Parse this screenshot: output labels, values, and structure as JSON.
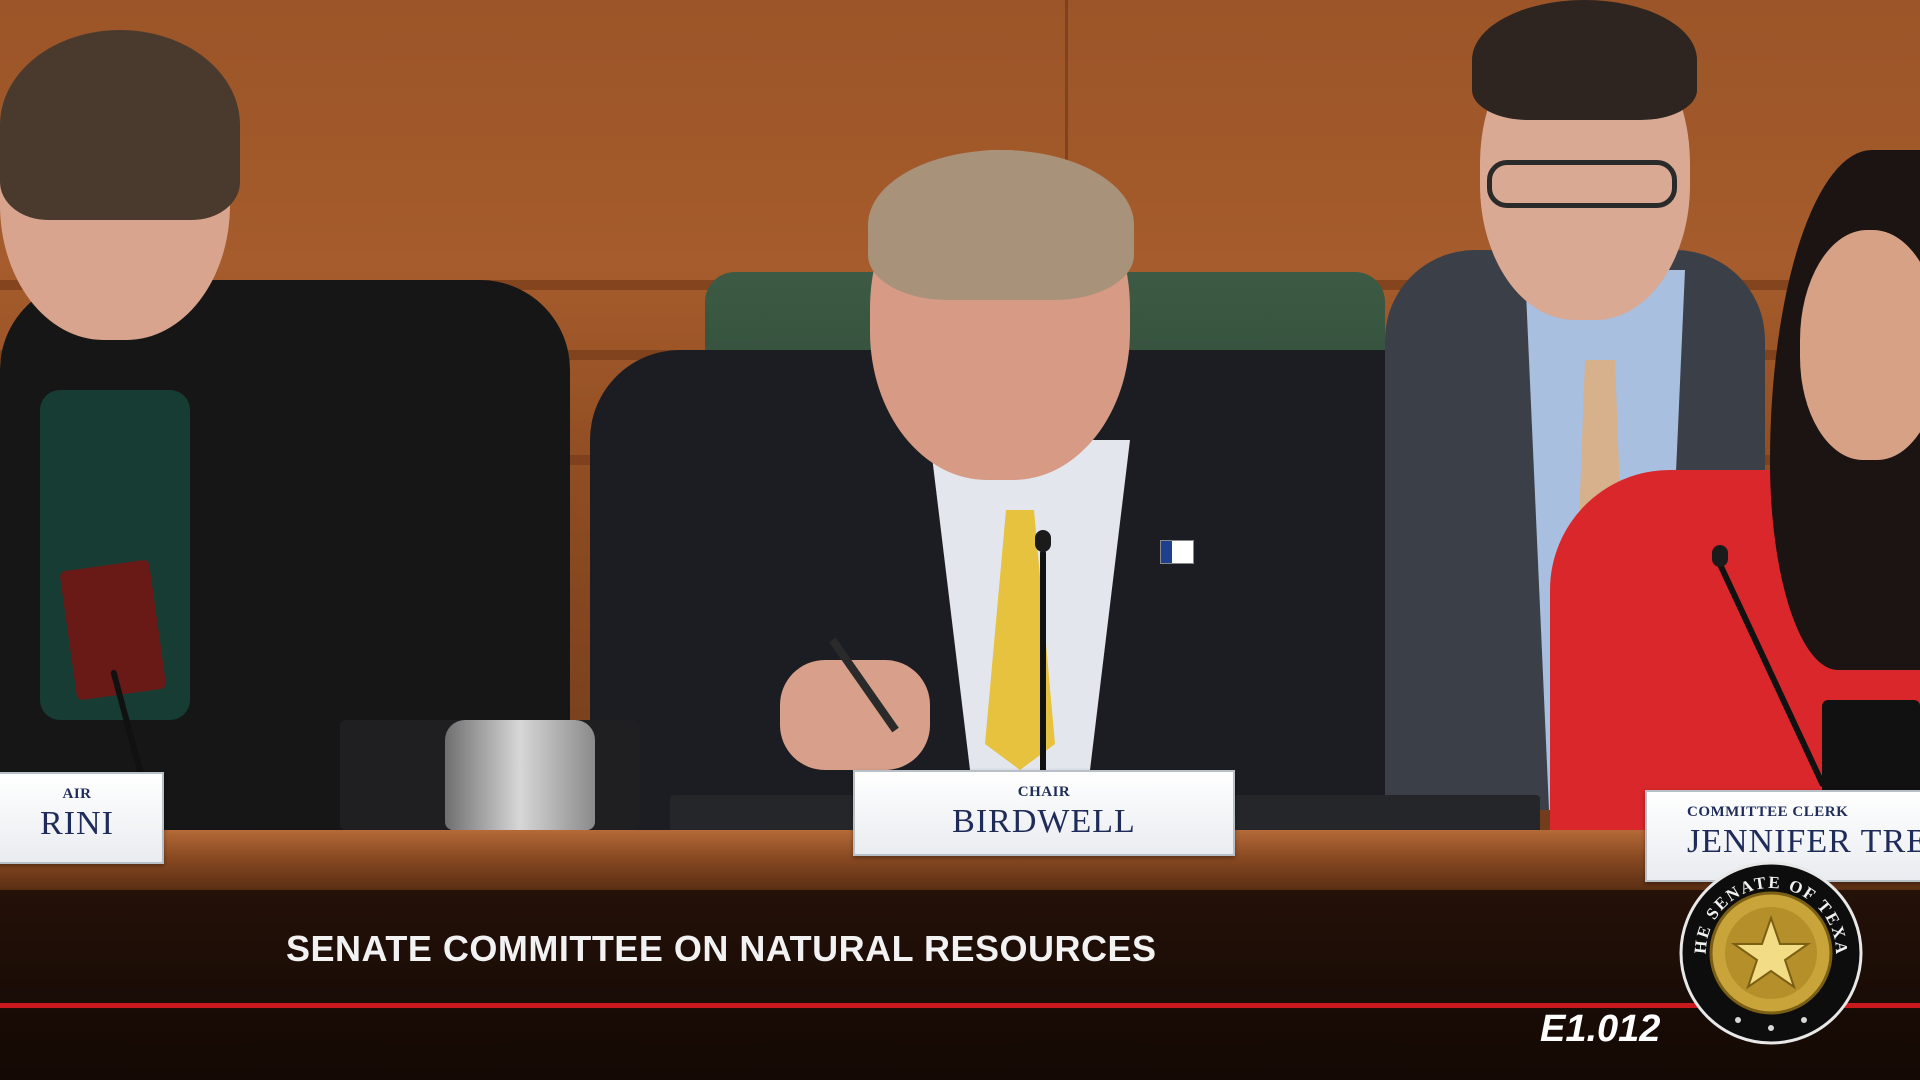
{
  "broadcast": {
    "committee_title": "SENATE COMMITTEE ON NATURAL RESOURCES",
    "room": "E1.012",
    "seal_text": "THE SENATE OF TEXAS"
  },
  "nameplates": [
    {
      "role": "AIR",
      "name": "RINI"
    },
    {
      "role": "CHAIR",
      "name": "BIRDWELL"
    },
    {
      "role": "COMMITTEE CLERK",
      "name": "JENNIFER TREV"
    }
  ],
  "colors": {
    "accent_red": "#c8191f",
    "banner_dark": "#1a0c06",
    "wood": "#9b5528",
    "nameplate_text": "#1f2c5a",
    "seal_gold": "#c9a43a"
  }
}
